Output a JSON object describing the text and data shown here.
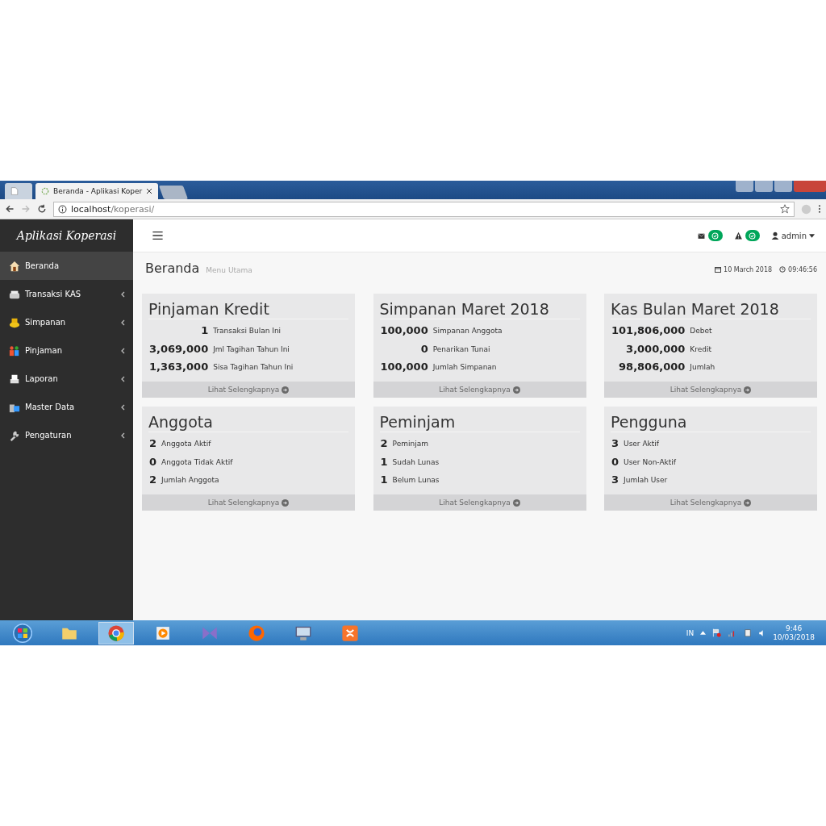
{
  "browser": {
    "tabs": [
      {
        "title": "Beranda - Aplikasi Koper",
        "selected": true
      }
    ],
    "address": {
      "host": "localhost",
      "path": "/koperasi/"
    }
  },
  "app": {
    "brand": "Aplikasi Koperasi",
    "user": "admin",
    "sidebar": {
      "items": [
        {
          "label": "Beranda",
          "selected": true,
          "expandable": false
        },
        {
          "label": "Transaksi KAS",
          "selected": false,
          "expandable": true
        },
        {
          "label": "Simpanan",
          "selected": false,
          "expandable": true
        },
        {
          "label": "Pinjaman",
          "selected": false,
          "expandable": true
        },
        {
          "label": "Laporan",
          "selected": false,
          "expandable": true
        },
        {
          "label": "Master Data",
          "selected": false,
          "expandable": true
        },
        {
          "label": "Pengaturan",
          "selected": false,
          "expandable": true
        }
      ]
    },
    "page": {
      "title": "Beranda",
      "subtitle": "Menu Utama",
      "date": "10 March 2018",
      "time": "09:46:56"
    },
    "cards": [
      {
        "title": "Pinjaman Kredit",
        "rows": [
          {
            "value": "1",
            "label": "Transaksi Bulan Ini"
          },
          {
            "value": "3,069,000",
            "label": "Jml Tagihan Tahun Ini"
          },
          {
            "value": "1,363,000",
            "label": "Sisa Tagihan Tahun Ini"
          }
        ],
        "link": "Lihat Selengkapnya"
      },
      {
        "title": "Simpanan Maret 2018",
        "rows": [
          {
            "value": "100,000",
            "label": "Simpanan Anggota"
          },
          {
            "value": "0",
            "label": "Penarikan Tunai"
          },
          {
            "value": "100,000",
            "label": "Jumlah Simpanan"
          }
        ],
        "link": "Lihat Selengkapnya"
      },
      {
        "title": "Kas Bulan Maret 2018",
        "rows": [
          {
            "value": "101,806,000",
            "label": "Debet"
          },
          {
            "value": "3,000,000",
            "label": "Kredit"
          },
          {
            "value": "98,806,000",
            "label": "Jumlah"
          }
        ],
        "link": "Lihat Selengkapnya"
      },
      {
        "title": "Anggota",
        "rows": [
          {
            "value": "2",
            "label": "Anggota Aktif"
          },
          {
            "value": "0",
            "label": "Anggota Tidak Aktif"
          },
          {
            "value": "2",
            "label": "Jumlah Anggota"
          }
        ],
        "link": "Lihat Selengkapnya"
      },
      {
        "title": "Peminjam",
        "rows": [
          {
            "value": "2",
            "label": "Peminjam"
          },
          {
            "value": "1",
            "label": "Sudah Lunas"
          },
          {
            "value": "1",
            "label": "Belum Lunas"
          }
        ],
        "link": "Lihat Selengkapnya"
      },
      {
        "title": "Pengguna",
        "rows": [
          {
            "value": "3",
            "label": "User Aktif"
          },
          {
            "value": "0",
            "label": "User Non-Aktif"
          },
          {
            "value": "3",
            "label": "Jumlah User"
          }
        ],
        "link": "Lihat Selengkapnya"
      }
    ]
  },
  "taskbar": {
    "language": "IN",
    "time": "9:46",
    "date": "10/03/2018"
  }
}
